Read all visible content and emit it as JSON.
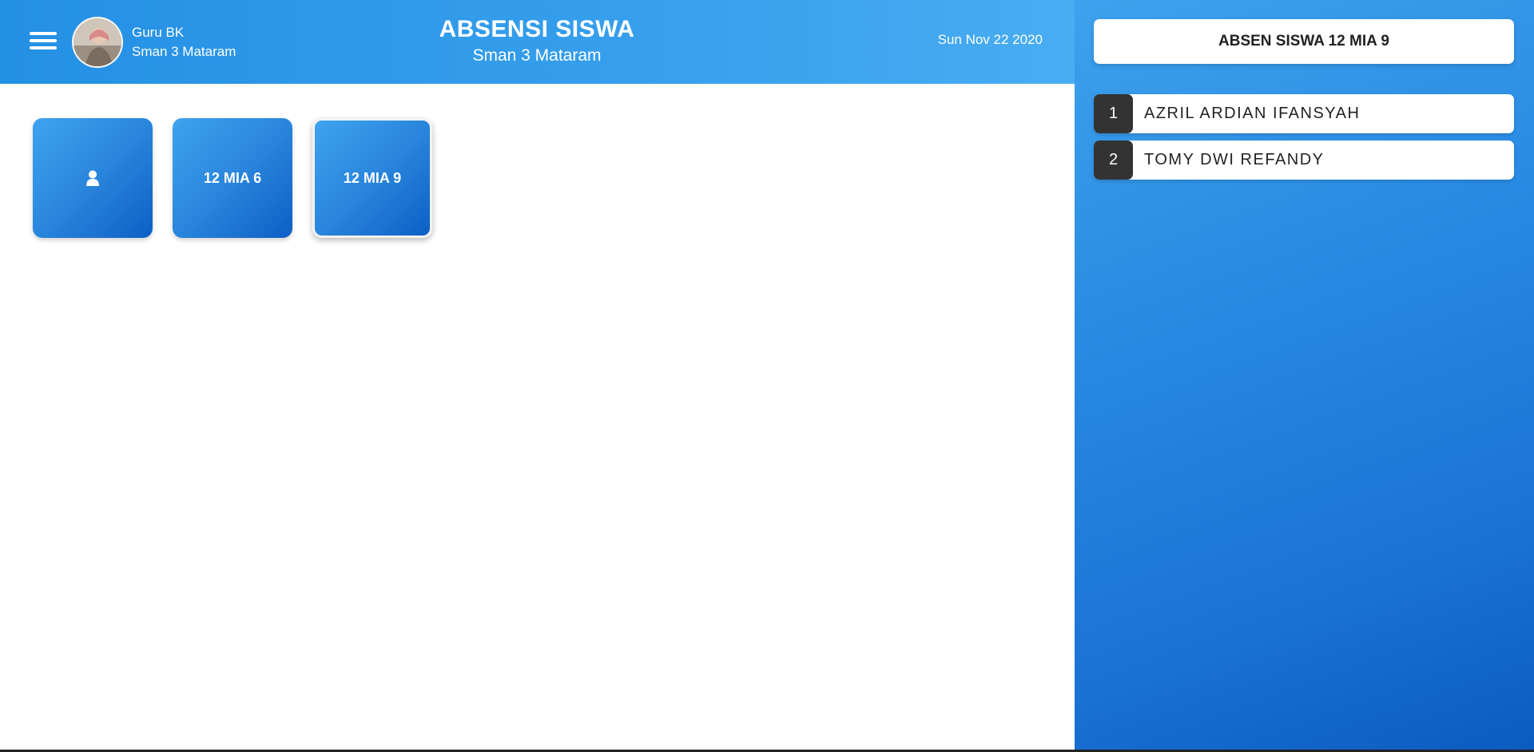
{
  "header": {
    "user_role": "Guru BK",
    "user_school": "Sman 3 Mataram",
    "title": "ABSENSI SISWA",
    "subtitle": "Sman 3 Mataram",
    "date": "Sun Nov 22 2020"
  },
  "tiles": [
    {
      "label": "",
      "icon": "user-icon"
    },
    {
      "label": "12 MIA 6"
    },
    {
      "label": "12 MIA 9",
      "selected": true
    }
  ],
  "side": {
    "title": "ABSEN SISWA 12 MIA 9",
    "students": [
      {
        "number": "1",
        "name": "AZRIL ARDIAN IFANSYAH"
      },
      {
        "number": "2",
        "name": "TOMY DWI REFANDY"
      }
    ]
  },
  "colors": {
    "header_blue": "#2490e4",
    "tile_blue": "#2a86dd",
    "number_badge": "#333333"
  }
}
